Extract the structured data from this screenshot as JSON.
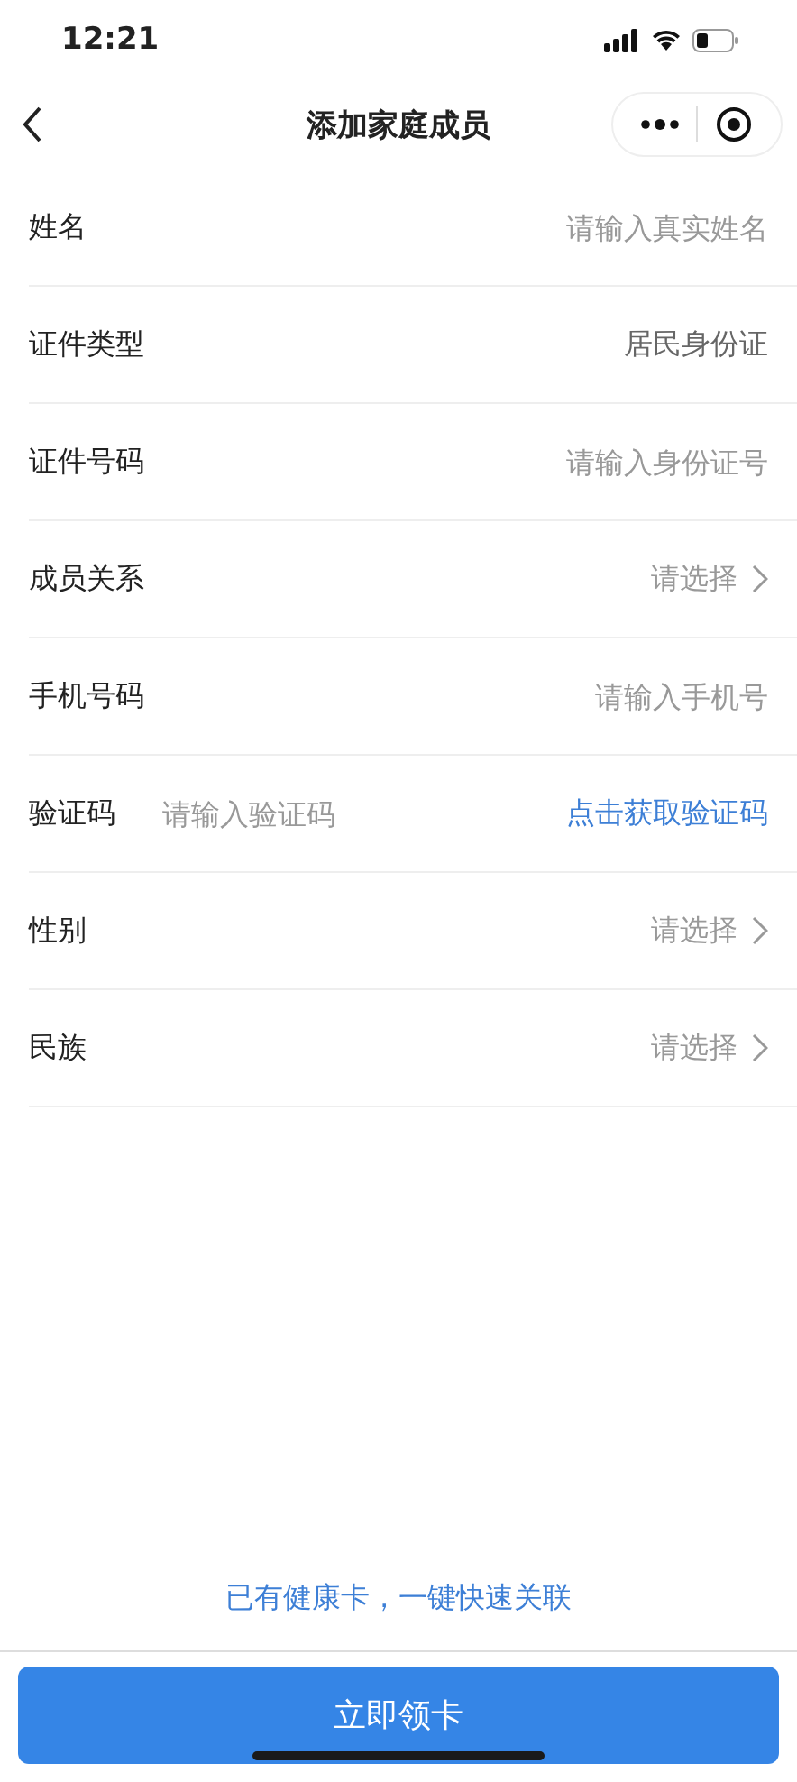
{
  "status_bar": {
    "time": "12:21"
  },
  "nav": {
    "title": "添加家庭成员"
  },
  "fields": [
    {
      "kind": "input",
      "label": "姓名",
      "placeholder": "请输入真实姓名"
    },
    {
      "kind": "value",
      "label": "证件类型",
      "value": "居民身份证"
    },
    {
      "kind": "input",
      "label": "证件号码",
      "placeholder": "请输入身份证号"
    },
    {
      "kind": "select",
      "label": "成员关系",
      "placeholder": "请选择"
    },
    {
      "kind": "input",
      "label": "手机号码",
      "placeholder": "请输入手机号"
    },
    {
      "kind": "code",
      "label": "验证码",
      "placeholder": "请输入验证码",
      "action": "点击获取验证码"
    },
    {
      "kind": "select",
      "label": "性别",
      "placeholder": "请选择"
    },
    {
      "kind": "select",
      "label": "民族",
      "placeholder": "请选择"
    }
  ],
  "link": "已有健康卡，一键快速关联",
  "button": "立即领卡"
}
